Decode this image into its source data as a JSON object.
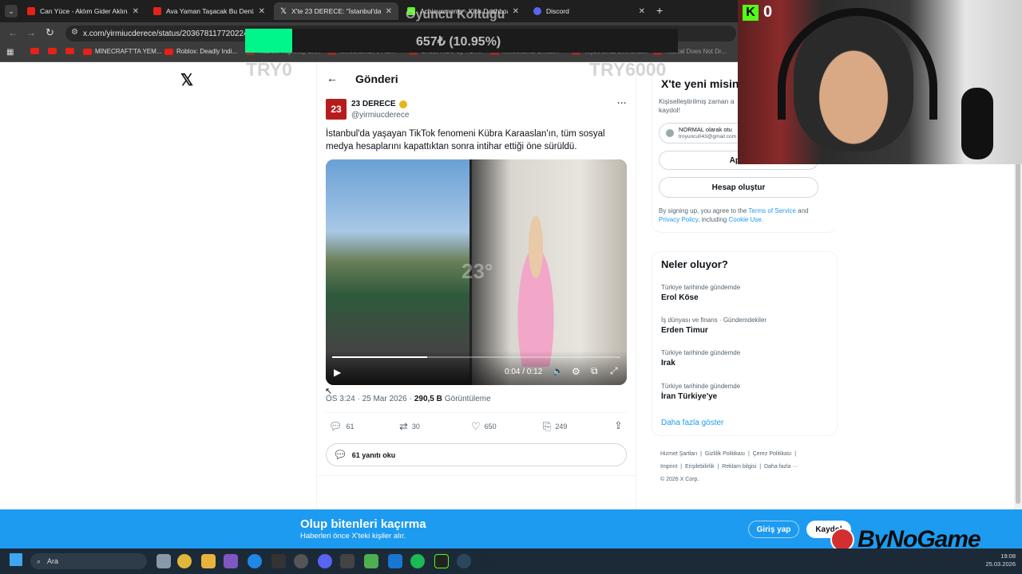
{
  "browser": {
    "tabs": [
      {
        "label": "Can Yüce - Aklım Gider Aklına (",
        "color": "#e62117"
      },
      {
        "label": "Ava Yaman Taşacak Bu Deniz O",
        "color": "#e62117"
      },
      {
        "label": "X'te 23 DERECE: \"İstanbul'da ya",
        "color": "#ffffff"
      },
      {
        "label": "Achievements - Kick Dashboard",
        "color": "#53fc18"
      },
      {
        "label": "Discord",
        "color": "#5865f2"
      }
    ],
    "url": "x.com/yirmiucderece/status/20367811772022417",
    "bookmarks": [
      "MİNECRAFT'TA YEM...",
      "Roblox: Deadly Indi...",
      "Roblox: Highway Sh...",
      "Minecraft'ta AFAC...",
      "Ghost Rider by YBY...",
      "Minecraft'ta Ghost...",
      "Teyze biraz sinirlendi...",
      "Rascal Does Not Dr..."
    ]
  },
  "overlay": {
    "title": "Oyuncu Koltuğu",
    "amount": "657₺ (10.95%)",
    "min": "TRY0",
    "max": "TRY6000",
    "progress": 0.1095
  },
  "header": {
    "title": "Gönderi"
  },
  "tweet": {
    "name": "23 DERECE",
    "handle": "@yirmiucderece",
    "avatar_text": "23",
    "text": "İstanbul'da yaşayan TikTok fenomeni Kübra Karaaslan'ın, tüm sosyal medya hesaplarını kapattıktan sonra intihar ettiği öne sürüldü.",
    "video_time": "0:04 / 0:12",
    "video_progress": 0.33,
    "watermark": "23°",
    "meta_time": "ÖS 3:24 · 25 Mar 2026 ·",
    "views": "290,5 B",
    "views_label": "Görüntüleme",
    "replies": "61",
    "reposts": "30",
    "likes": "650",
    "bookmarks": "249",
    "read_replies": "61 yanıtı oku"
  },
  "signup": {
    "title": "X'te yeni misin",
    "desc": "Kişiselleştirilmiş zaman a kaydol!",
    "google_name": "NORMAL olarak otu",
    "google_email": "troyuncu043@gmail.com",
    "apple": "Apple",
    "create": "Hesap oluştur",
    "legal_pre": "By signing up, you agree to the ",
    "terms": "Terms of Service",
    "and": " and ",
    "privacy": "Privacy Policy",
    "including": ", including ",
    "cookie": "Cookie Use",
    "dot": "."
  },
  "trends": {
    "title": "Neler oluyor?",
    "items": [
      {
        "context": "Türkiye tarihinde gündemde",
        "name": "Erol Köse"
      },
      {
        "context": "İş dünyası ve finans · Gündemdekiler",
        "name": "Erden Timur"
      },
      {
        "context": "Türkiye tarihinde gündemde",
        "name": "Irak"
      },
      {
        "context": "Türkiye tarihinde gündemde",
        "name": "İran Türkiye'ye"
      }
    ],
    "more": "Daha fazla göster"
  },
  "footer": {
    "links": [
      "Hizmet Şartları",
      "Gizlilik Politikası",
      "Çerez Politikası",
      "Imprint",
      "Erişilebilirlik",
      "Reklam bilgisi",
      "Daha fazla ···"
    ],
    "copyright": "© 2026 X Corp."
  },
  "banner": {
    "title": "Olup bitenleri kaçırma",
    "subtitle": "Haberleri önce X'teki kişiler alır.",
    "login": "Giriş yap",
    "signup": "Kaydol"
  },
  "stream": {
    "kick_count": "0",
    "sponsor": "ByNoGame"
  },
  "taskbar": {
    "search": "Ara",
    "time": "19:08",
    "date": "25.03.2026"
  },
  "colors": {
    "accent": "#1d9bf0",
    "kick": "#53fc18",
    "overlay_fill": "#00f58a"
  }
}
